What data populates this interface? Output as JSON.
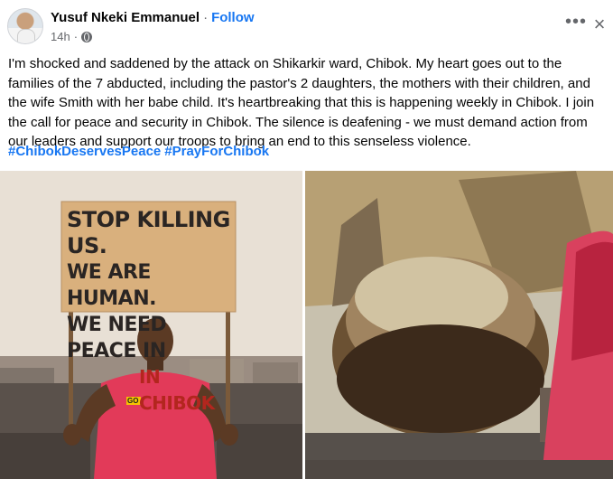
{
  "post": {
    "author": "Yusuf Nkeki Emmanuel",
    "separator": "·",
    "follow_label": "Follow",
    "time": "14h",
    "time_separator": "·",
    "more_icon": "more-horizontal-icon",
    "close_icon": "close-icon",
    "privacy_icon": "globe-icon",
    "body": "I'm shocked and saddened by the attack on Shikarkir ward, Chibok. My heart goes out to the families of the 7 abducted, including the pastor's 2 daughters, the mothers with their children, and the wife Smith with her babe child. It's heartbreaking that this is happening weekly in Chibok. I join the call for peace and security in Chibok. The silence is deafening - we must demand action from our leaders and support our troops to bring an end to this senseless violence.",
    "hashtags": [
      "#ChibokDeservesPeace",
      "#PrayForChibok"
    ]
  },
  "photo_left": {
    "sign_lines": [
      "STOP KILLING US.",
      "WE ARE HUMAN.",
      "WE NEED PEACE IN"
    ],
    "sign_red_line": "IN CHIBOK",
    "shirt_logo": "GO"
  },
  "colors": {
    "link": "#1877f2",
    "secondary_text": "#65676b",
    "sign_board": "#d9b07d",
    "sign_red": "#b3261e",
    "shirt": "#e23a59"
  }
}
